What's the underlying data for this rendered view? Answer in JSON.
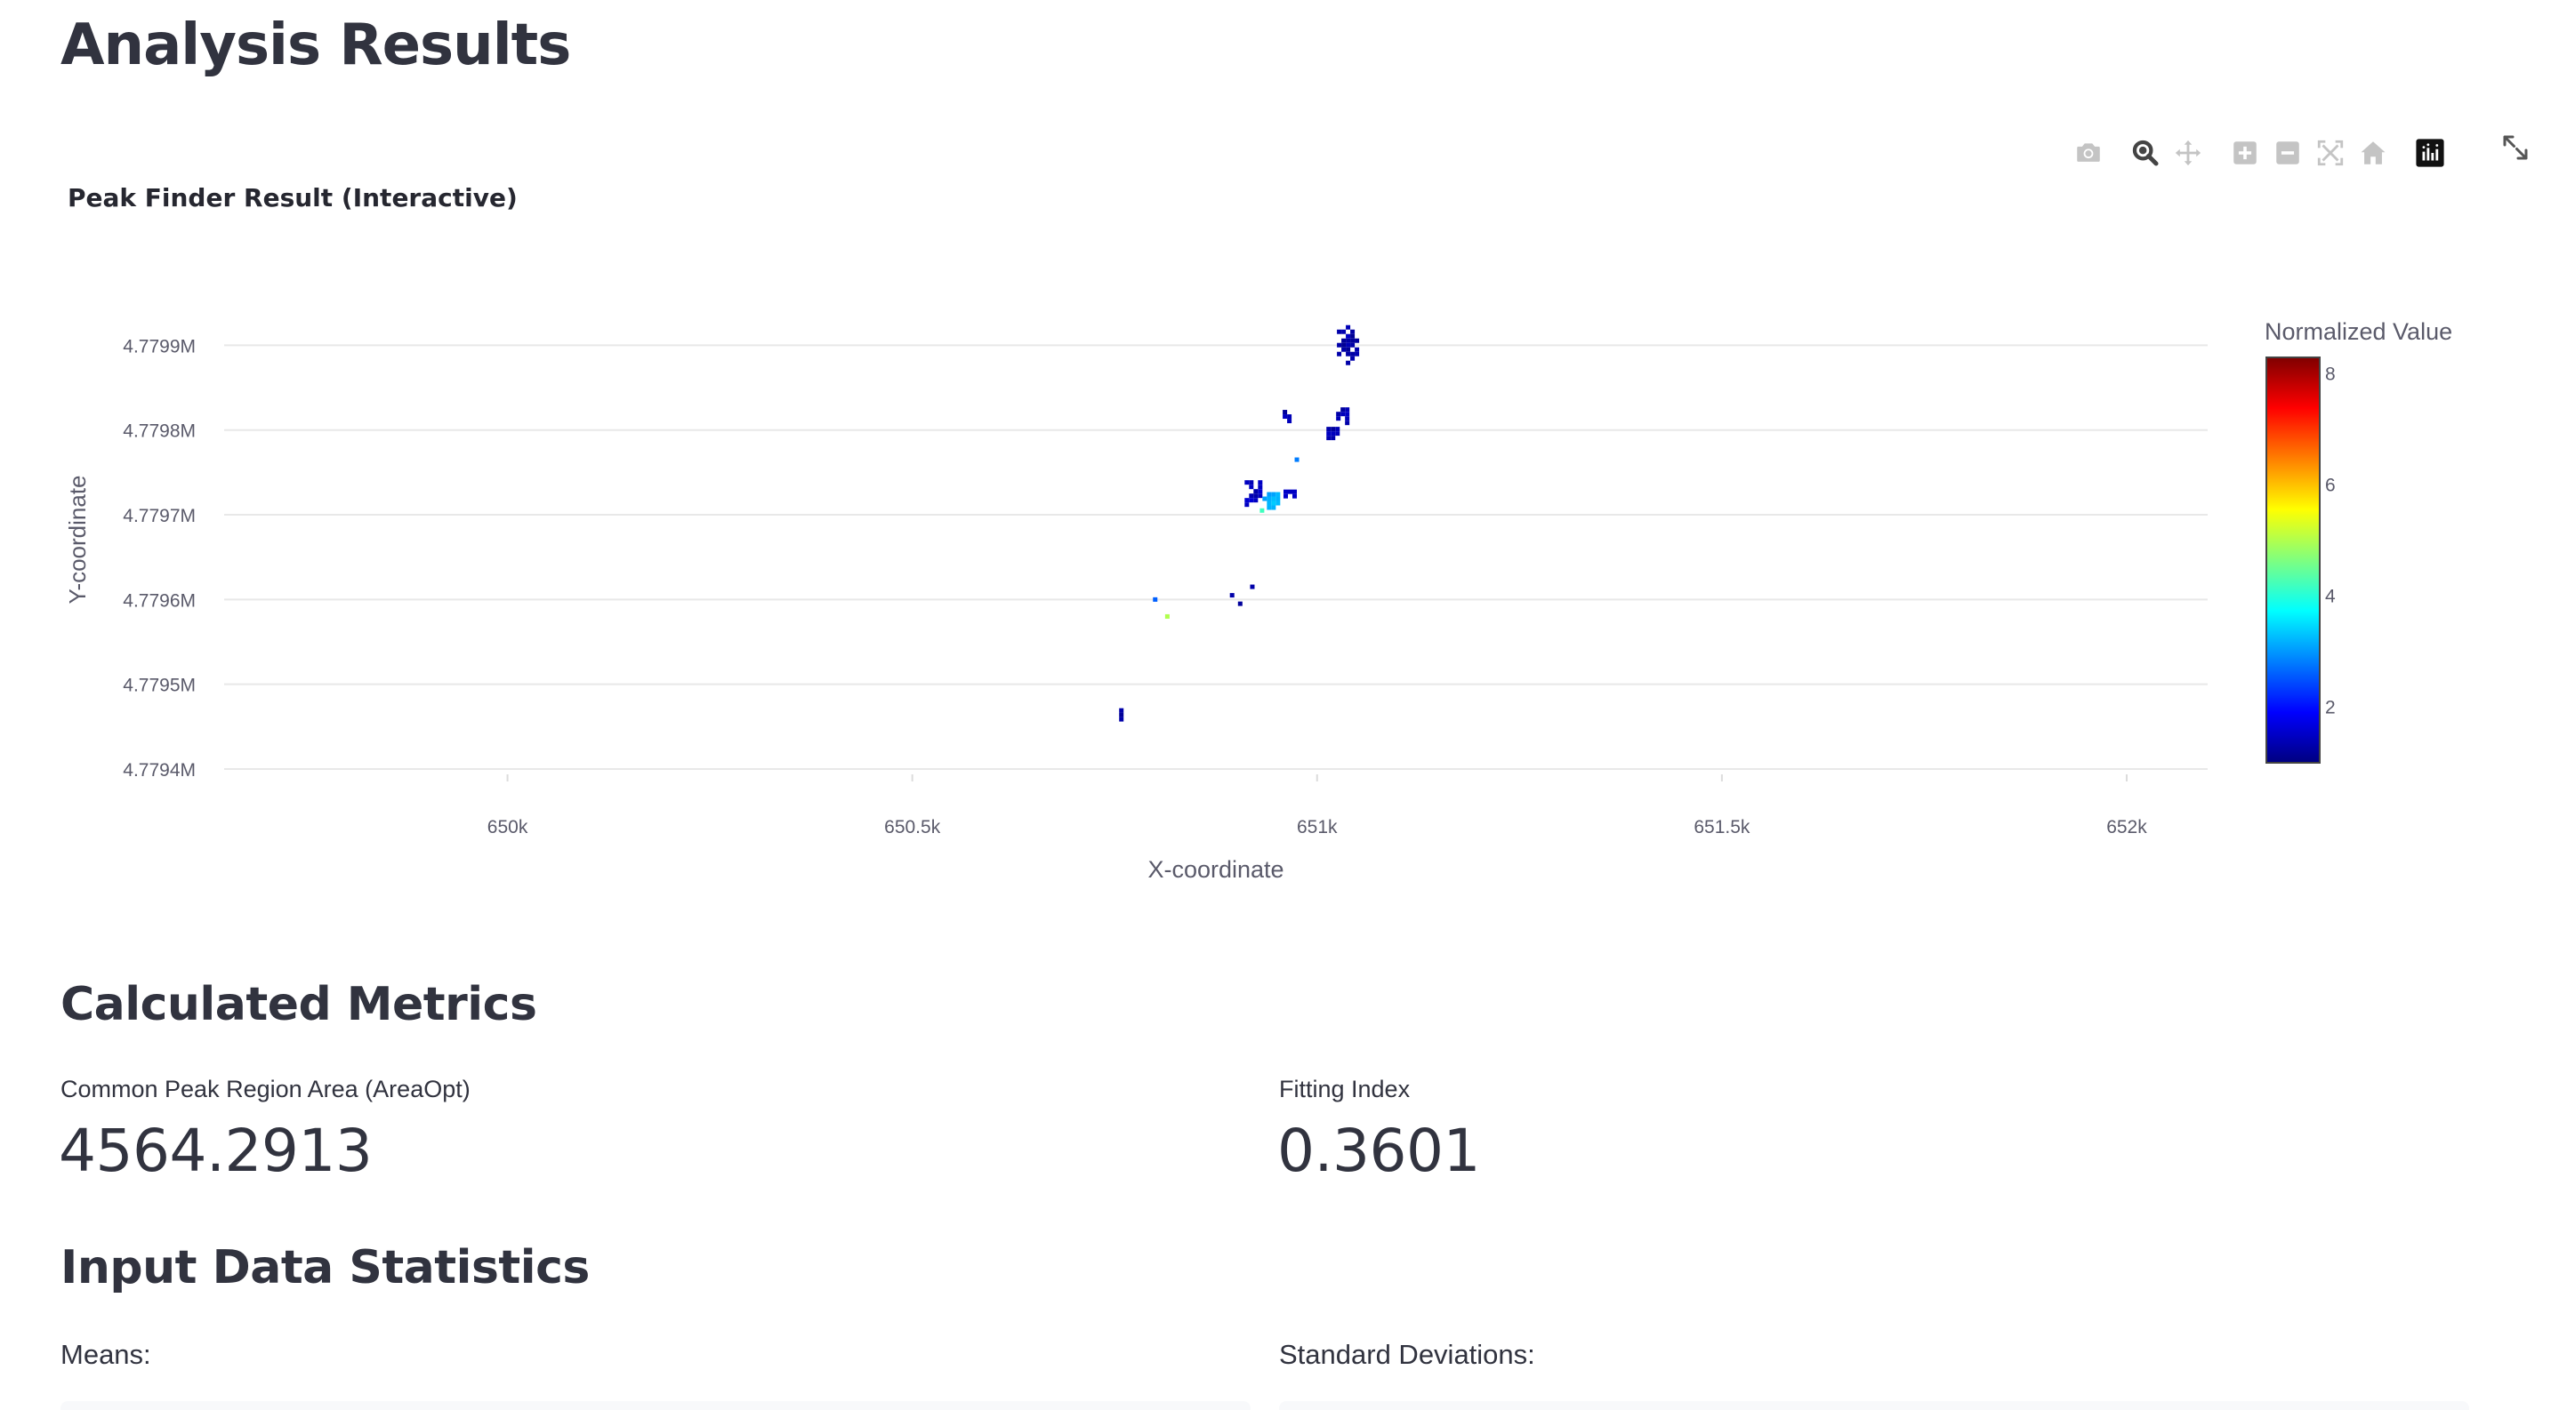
{
  "page": {
    "title": "Analysis Results"
  },
  "chart_section": {
    "title": "Peak Finder Result (Interactive)",
    "modebar": [
      {
        "icon": "camera-icon",
        "action": "download-plot"
      },
      {
        "icon": "zoom-icon",
        "action": "zoom"
      },
      {
        "icon": "pan-icon",
        "action": "pan"
      },
      {
        "icon": "zoom-in-icon",
        "action": "zoom-in"
      },
      {
        "icon": "zoom-out-icon",
        "action": "zoom-out"
      },
      {
        "icon": "autoscale-icon",
        "action": "autoscale"
      },
      {
        "icon": "home-icon",
        "action": "reset-axes"
      },
      {
        "icon": "plotly-logo-icon",
        "action": "plotly"
      }
    ],
    "fullscreen_icon": "expand-icon"
  },
  "chart_data": {
    "type": "heatmap",
    "title": "",
    "xlabel": "X-coordinate",
    "ylabel": "Y-coordinate",
    "x_ticks": [
      650000,
      650500,
      651000,
      651500,
      652000
    ],
    "x_tick_labels": [
      "650k",
      "650.5k",
      "651k",
      "651.5k",
      "652k"
    ],
    "y_ticks": [
      4779400,
      4779500,
      4779600,
      4779700,
      4779800,
      4779900
    ],
    "y_tick_labels": [
      "4.7794M",
      "4.7795M",
      "4.7796M",
      "4.7797M",
      "4.7798M",
      "4.7799M"
    ],
    "xlim": [
      649650,
      652100
    ],
    "ylim": [
      4779400,
      4779935
    ],
    "grid": true,
    "colorbar": {
      "title": "Normalized Value",
      "range": [
        1,
        8.3
      ],
      "ticks": [
        2,
        4,
        6,
        8
      ],
      "colorscale": [
        "#00007f",
        "#0000ff",
        "#007fff",
        "#00ffff",
        "#7fff7f",
        "#ffff00",
        "#ff7f00",
        "#ff0000",
        "#7f0000"
      ]
    },
    "clusters": [
      {
        "x": 651035,
        "y": 4779905,
        "rx": 16,
        "ry": 24,
        "value": 1.3
      },
      {
        "x": 651030,
        "y": 4779820,
        "rx": 12,
        "ry": 12,
        "value": 1.3
      },
      {
        "x": 651015,
        "y": 4779800,
        "rx": 9,
        "ry": 9,
        "value": 1.4
      },
      {
        "x": 650960,
        "y": 4779818,
        "rx": 8,
        "ry": 11,
        "value": 1.3
      },
      {
        "x": 650918,
        "y": 4779728,
        "rx": 13,
        "ry": 18,
        "value": 1.5
      },
      {
        "x": 650940,
        "y": 4779720,
        "rx": 13,
        "ry": 12,
        "value": 3.2
      },
      {
        "x": 650962,
        "y": 4779728,
        "rx": 9,
        "ry": 7,
        "value": 1.5
      },
      {
        "x": 650755,
        "y": 4779465,
        "rx": 5,
        "ry": 12,
        "value": 1.2
      }
    ],
    "points": [
      {
        "x": 650975,
        "y": 4779765,
        "value": 2.8
      },
      {
        "x": 650800,
        "y": 4779600,
        "value": 2.6
      },
      {
        "x": 650815,
        "y": 4779580,
        "value": 5.0
      },
      {
        "x": 650895,
        "y": 4779605,
        "value": 1.3
      },
      {
        "x": 650905,
        "y": 4779595,
        "value": 1.2
      },
      {
        "x": 650920,
        "y": 4779615,
        "value": 1.3
      },
      {
        "x": 650932,
        "y": 4779705,
        "value": 4.2
      }
    ]
  },
  "metrics_section": {
    "heading": "Calculated Metrics",
    "metrics": [
      {
        "label": "Common Peak Region Area (AreaOpt)",
        "value": "4564.2913"
      },
      {
        "label": "Fitting Index",
        "value": "0.3601"
      }
    ]
  },
  "stats_section": {
    "heading": "Input Data Statistics",
    "means_label": "Means:",
    "std_label": "Standard Deviations:"
  }
}
